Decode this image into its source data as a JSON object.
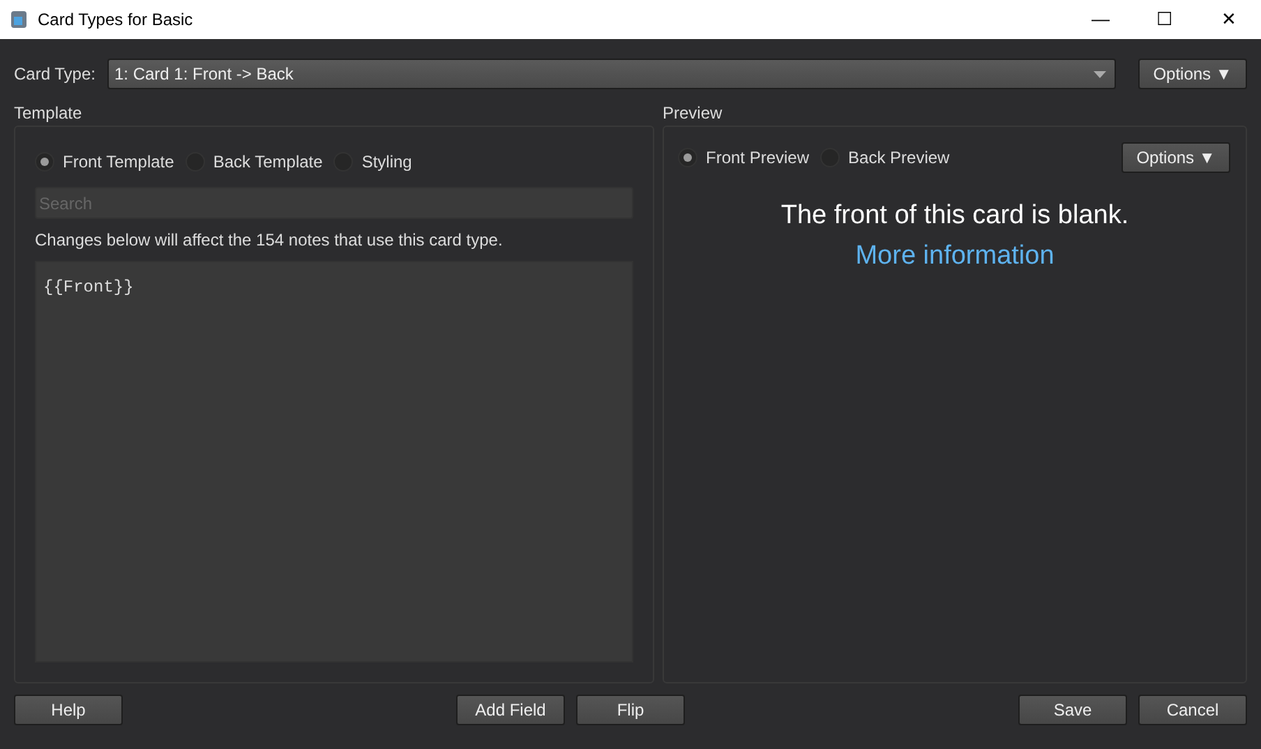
{
  "window": {
    "title": "Card Types for Basic",
    "controls": [
      "—",
      "☐",
      "✕"
    ]
  },
  "card_type": {
    "label": "Card Type:",
    "value": "1: Card 1: Front -> Back",
    "options_button": "Options ▼"
  },
  "template": {
    "title": "Template",
    "tabs": [
      {
        "label": "Front Template",
        "selected": true
      },
      {
        "label": "Back Template",
        "selected": false
      },
      {
        "label": "Styling",
        "selected": false
      }
    ],
    "search": {
      "placeholder": "Search"
    },
    "notice": "Changes below will affect the 154 notes that use this card type.",
    "editor": "{{Front}}"
  },
  "preview": {
    "title": "Preview",
    "tabs": [
      {
        "label": "Front Preview",
        "selected": true
      },
      {
        "label": "Back Preview",
        "selected": false
      }
    ],
    "options_button": "Options ▼",
    "message": "The front of this card is blank.",
    "link": "More information"
  },
  "buttons": {
    "left": [
      "Help"
    ],
    "center": [
      "Add Field",
      "Flip"
    ],
    "right": [
      "Save",
      "Cancel"
    ]
  }
}
